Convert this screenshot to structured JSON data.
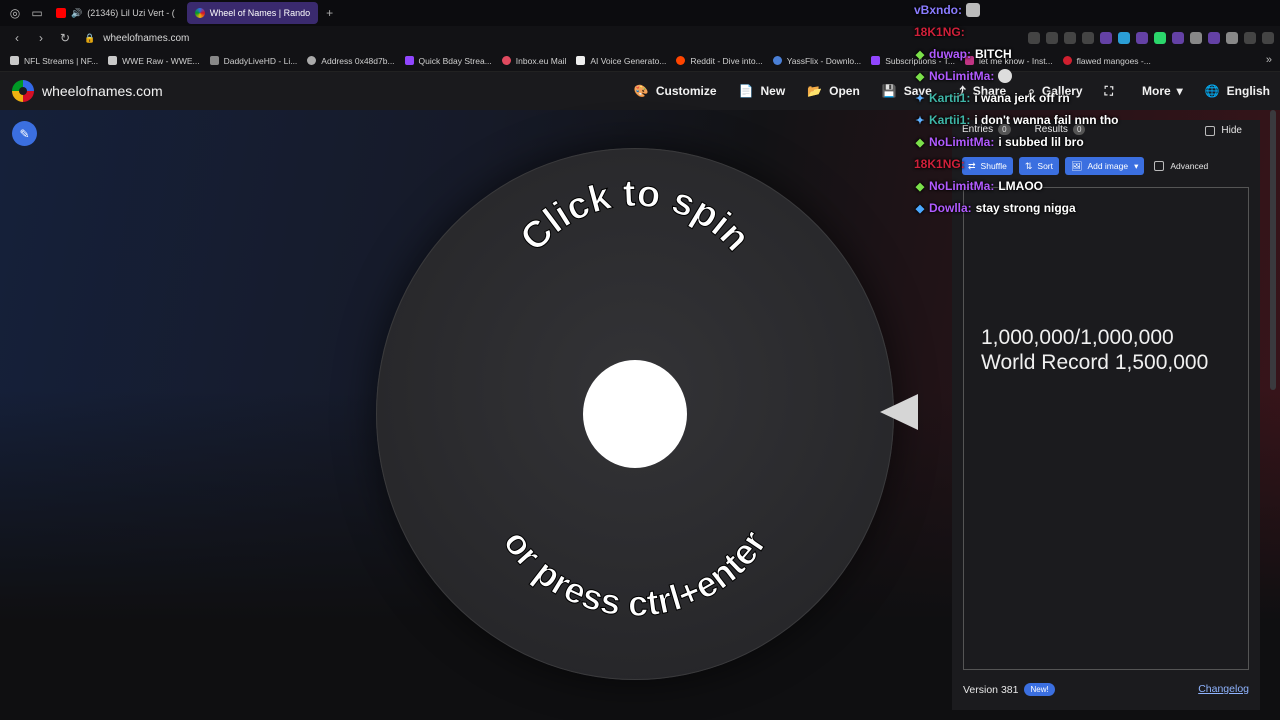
{
  "browser": {
    "tabs": [
      {
        "label": "(21346) Lil Uzi Vert - (",
        "icon": "youtube-icon",
        "active": false
      },
      {
        "label": "Wheel of Names | Rando",
        "icon": "wheel-icon",
        "active": true
      }
    ],
    "url": "wheelofnames.com",
    "bookmarks": [
      {
        "label": "NFL Streams | NF..."
      },
      {
        "label": "WWE Raw - WWE..."
      },
      {
        "label": "DaddyLiveHD - Li..."
      },
      {
        "label": "Address 0x48d7b..."
      },
      {
        "label": "Quick Bday Strea..."
      },
      {
        "label": "Inbox.eu Mail"
      },
      {
        "label": "AI Voice Generato..."
      },
      {
        "label": "Reddit - Dive into..."
      },
      {
        "label": "YassFlix - Downlo..."
      },
      {
        "label": "Subscriptions - T..."
      },
      {
        "label": "let me know - Inst..."
      },
      {
        "label": "flawed mangoes -..."
      }
    ]
  },
  "site": {
    "name": "wheelofnames.com",
    "menu": {
      "customize": "Customize",
      "new": "New",
      "open": "Open",
      "save": "Save",
      "share": "Share",
      "gallery": "Gallery",
      "more": "More",
      "language": "English"
    }
  },
  "wheel": {
    "top_text": "Click to spin",
    "bottom_text": "or press ctrl+enter"
  },
  "panel": {
    "entries_label": "Entries",
    "entries_count": "0",
    "results_label": "Results",
    "results_count": "0",
    "hide_label": "Hide",
    "shuffle_label": "Shuffle",
    "sort_label": "Sort",
    "add_image_label": "Add image",
    "advanced_label": "Advanced",
    "entries_text_line1": "1,000,000/1,000,000",
    "entries_text_line2": "World Record 1,500,000",
    "version_label": "Version 381",
    "new_badge": "New!",
    "changelog_label": "Changelog"
  },
  "chat": [
    {
      "user": "vBxndo:",
      "message": "",
      "color": "#8a7cff",
      "icon": ""
    },
    {
      "user": "18K1NG:",
      "message": "",
      "color": "#d0203a",
      "icon": ""
    },
    {
      "user": "duwap:",
      "message": "BITCH",
      "color": "#b15bff",
      "icon": "diamond-icon"
    },
    {
      "user": "NoLimitMa:",
      "message": "",
      "color": "#b15bff",
      "icon": "diamond-icon"
    },
    {
      "user": "Kartii1:",
      "message": "i wana jerk off rn",
      "color": "#3fb6a8",
      "icon": "sword-icon"
    },
    {
      "user": "Kartii1:",
      "message": "i don't wanna fail nnn tho",
      "color": "#3fb6a8",
      "icon": "sword-icon"
    },
    {
      "user": "NoLimitMa:",
      "message": "i subbed lil bro",
      "color": "#b15bff",
      "icon": "diamond-icon"
    },
    {
      "user": "18K1NG:",
      "message": "",
      "color": "#d0203a",
      "icon": ""
    },
    {
      "user": "NoLimitMa:",
      "message": "LMAOO",
      "color": "#b15bff",
      "icon": "diamond-icon"
    },
    {
      "user": "Dowlla:",
      "message": "stay strong nigga",
      "color": "#b15bff",
      "icon": "cube-icon"
    }
  ],
  "colors": {
    "accent": "#3b6fe0",
    "header_bg": "#1a1a1d",
    "panel_bg": "#1b1b1e"
  }
}
